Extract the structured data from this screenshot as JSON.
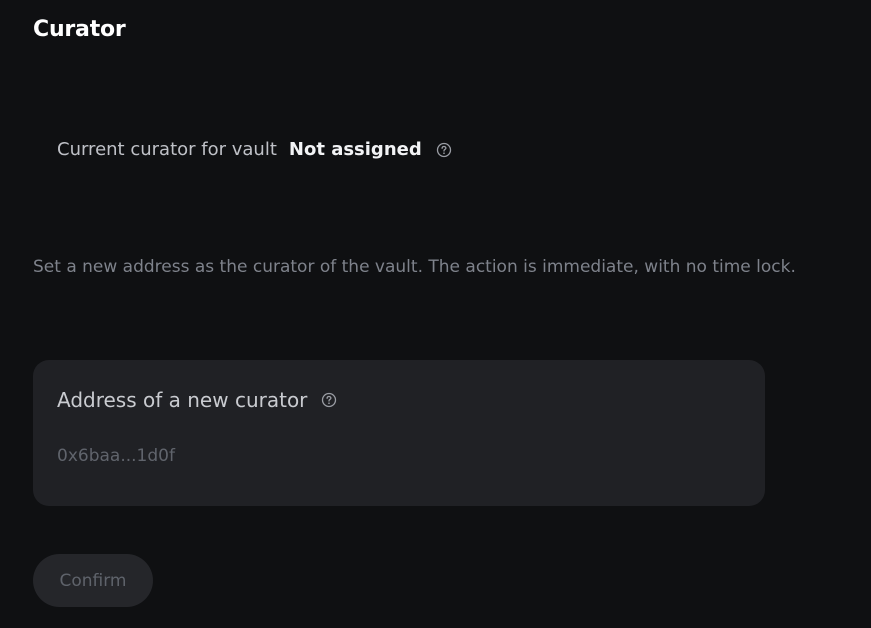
{
  "header": {
    "title": "Curator"
  },
  "current_curator": {
    "label": "Current curator for vault",
    "value": "Not assigned",
    "help_icon": "question-circle-icon"
  },
  "description": "Set a new address as the curator of the vault. The action is immediate, with no time lock.",
  "new_curator": {
    "label": "Address of a new curator",
    "help_icon": "question-circle-icon",
    "input_value": "",
    "placeholder": "0x6baa...1d0f"
  },
  "actions": {
    "confirm_label": "Confirm",
    "confirm_disabled": true
  },
  "colors": {
    "background": "#0f1012",
    "card": "#202125",
    "button_disabled_bg": "#25262a",
    "muted_text": "#7e828b"
  }
}
